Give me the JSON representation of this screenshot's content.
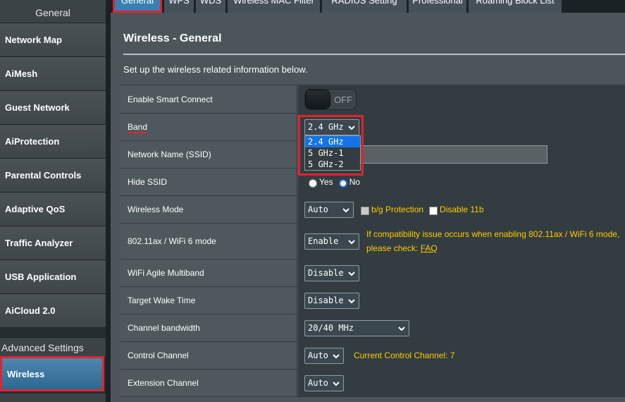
{
  "sidebar": {
    "header": "General",
    "items": [
      {
        "label": "Network Map"
      },
      {
        "label": "AiMesh"
      },
      {
        "label": "Guest Network"
      },
      {
        "label": "AiProtection"
      },
      {
        "label": "Parental Controls"
      },
      {
        "label": "Adaptive QoS"
      },
      {
        "label": "Traffic Analyzer"
      },
      {
        "label": "USB Application"
      },
      {
        "label": "AiCloud 2.0"
      }
    ],
    "advanced_header": "Advanced Settings",
    "active_item": "Wireless"
  },
  "tabs": [
    {
      "label": "General"
    },
    {
      "label": "WPS"
    },
    {
      "label": "WDS"
    },
    {
      "label": "Wireless MAC Filter"
    },
    {
      "label": "RADIUS Setting"
    },
    {
      "label": "Professional"
    },
    {
      "label": "Roaming Block List"
    }
  ],
  "page": {
    "title": "Wireless - General",
    "description": "Set up the wireless related information below."
  },
  "settings": {
    "smart_connect": {
      "label": "Enable Smart Connect",
      "state": "OFF"
    },
    "band": {
      "label": "Band",
      "value": "2.4 GHz",
      "options": [
        "2.4 GHz",
        "5 GHz-1",
        "5 GHz-2"
      ]
    },
    "ssid": {
      "label": "Network Name (SSID)",
      "value": ""
    },
    "hide_ssid": {
      "label": "Hide SSID",
      "yes": "Yes",
      "no": "No",
      "selected": "No"
    },
    "wireless_mode": {
      "label": "Wireless Mode",
      "value": "Auto",
      "bg_protection": "b/g Protection",
      "disable_11b": "Disable 11b"
    },
    "wifi6": {
      "label": "802.11ax / WiFi 6 mode",
      "value": "Enable",
      "note": "If compatibility issue occurs when enabling 802.11ax / WiFi 6 mode,",
      "note2": "please check:",
      "faq": "FAQ"
    },
    "agile": {
      "label": "WiFi Agile Multiband",
      "value": "Disable"
    },
    "twt": {
      "label": "Target Wake Time",
      "value": "Disable"
    },
    "bandwidth": {
      "label": "Channel bandwidth",
      "value": "20/40 MHz"
    },
    "control_channel": {
      "label": "Control Channel",
      "value": "Auto",
      "current": "Current Control Channel: 7"
    },
    "extension_channel": {
      "label": "Extension Channel",
      "value": "Auto"
    }
  },
  "colors": {
    "accent": "#e3222f",
    "highlight": "#ffcc00",
    "selected": "#1473e6"
  }
}
